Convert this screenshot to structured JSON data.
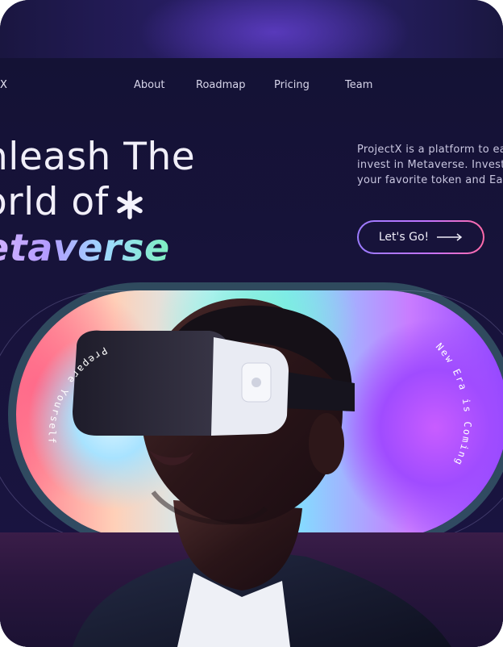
{
  "brand": {
    "logo_text": "X"
  },
  "nav": {
    "items": [
      {
        "label": "About"
      },
      {
        "label": "Roadmap"
      },
      {
        "label": "Pricing"
      },
      {
        "label": "Team"
      }
    ]
  },
  "hero": {
    "headline_line1": "nleash The",
    "headline_line2": "orld of",
    "headline_line3": "etaverse",
    "description_lines": [
      "ProjectX is a platform to ea",
      "invest  in Metaverse. Invest",
      "your favorite token and Earn"
    ],
    "cta_label": "Let's Go!"
  },
  "visual": {
    "left_badge": "Prepare Yourself",
    "right_badge": "New Era is Coming"
  },
  "colors": {
    "background": "#14102f",
    "accent_gradient_start": "#9b7bff",
    "accent_gradient_end": "#ff6aa8",
    "metaverse_gradient": [
      "#d7b6ff",
      "#9ed9ff",
      "#7ef0c0"
    ]
  },
  "icons": [
    "star-icon",
    "arrow-right-icon"
  ]
}
